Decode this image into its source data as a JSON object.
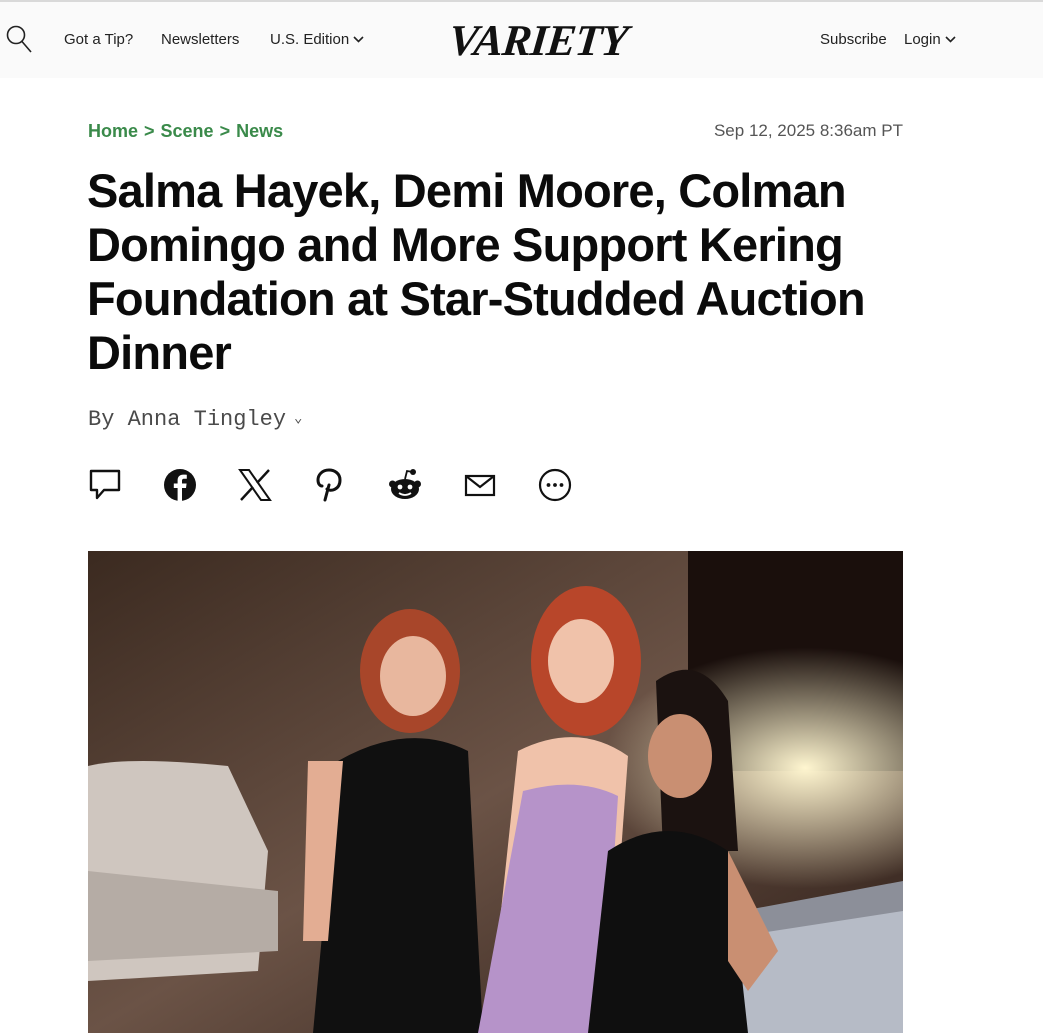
{
  "header": {
    "nav_links": [
      "Got a Tip?",
      "Newsletters",
      "U.S. Edition"
    ],
    "logo_text": "VARIETY",
    "subscribe": "Subscribe",
    "login": "Login"
  },
  "breadcrumb": {
    "items": [
      "Home",
      "Scene",
      "News"
    ],
    "separator": ">"
  },
  "date": "Sep 12, 2025 8:36am PT",
  "headline": "Salma Hayek, Demi Moore, Colman Domingo and More Support Kering Foundation at Star-Studded Auction Dinner",
  "byline": "By Anna Tingley",
  "share_icons": [
    "comment-icon",
    "facebook-icon",
    "x-icon",
    "pinterest-icon",
    "reddit-icon",
    "email-icon",
    "more-icon"
  ],
  "colors": {
    "breadcrumb": "#3a8a4a",
    "headline": "#0b0b0b",
    "date": "#555555"
  }
}
